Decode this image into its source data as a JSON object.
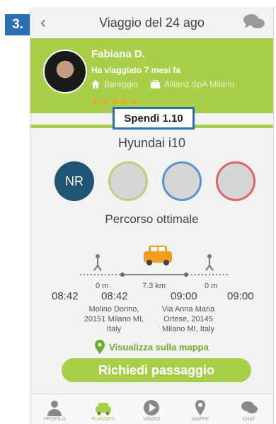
{
  "step_badge": "3.",
  "header": {
    "title": "Viaggio del 24 ago"
  },
  "profile": {
    "name": "Fabiana D.",
    "travel_time": "Ha viaggiato 7 mesi fa",
    "home": "Bareggio",
    "company": "Allianz SpA Milano",
    "stars": "★★★★★"
  },
  "spend": {
    "label": "Spendi 1.10"
  },
  "car": {
    "model": "Hyundai i10"
  },
  "seats": {
    "first_label": "NR"
  },
  "route": {
    "title": "Percorso ottimale",
    "walk_start_distance": "0 m",
    "drive_distance": "7.3 km",
    "walk_end_distance": "0 m",
    "time_start_walk": "08:42",
    "time_pickup": "08:42",
    "time_dropoff": "09:00",
    "time_end_walk": "09:00",
    "pickup_address": [
      "Molino Dorino,",
      "20151 Milano MI,",
      "Italy"
    ],
    "dropoff_address": [
      "Via Anna Maria",
      "Ortese, 20145",
      "Milano MI, Italy"
    ]
  },
  "map_link": "Visualizza sulla mappa",
  "cta": "Richiedi passaggio",
  "tabs": [
    {
      "label": "PROFILO"
    },
    {
      "label": "PLANNER"
    },
    {
      "label": "VIAGGI"
    },
    {
      "label": "MAPPE"
    },
    {
      "label": "CHAT"
    }
  ],
  "colors": {
    "brand_green": "#a9cf4a",
    "badge_blue": "#2a6fb4",
    "seat_dark": "#1f5472"
  }
}
